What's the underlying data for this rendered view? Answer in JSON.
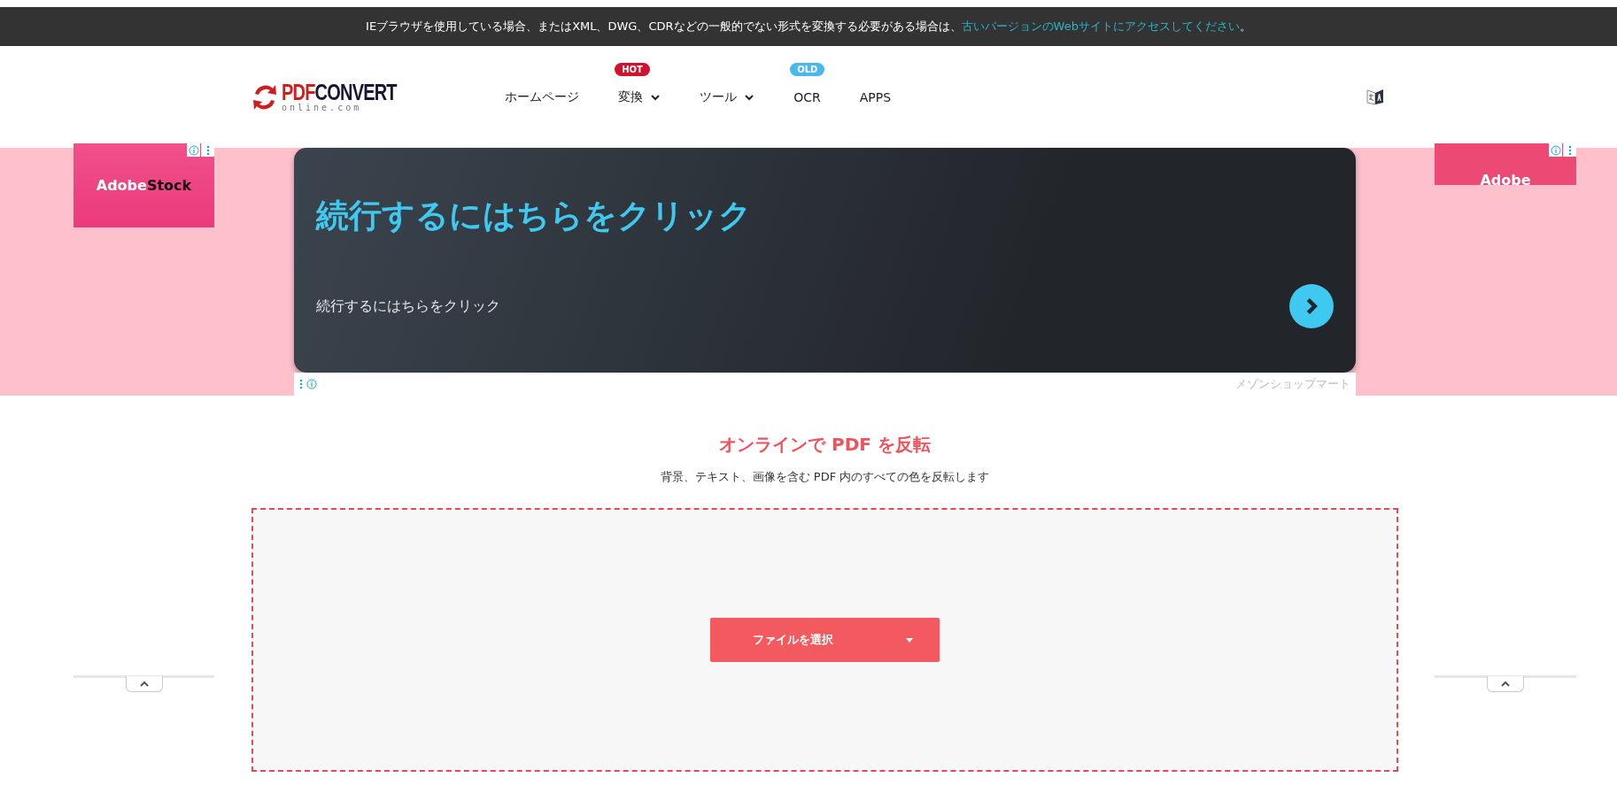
{
  "notice_bar": {
    "text": "IEブラウザを使用している場合、またはXML、DWG、CDRなどの一般的でない形式を変換する必要がある場合は、",
    "link": "古いバージョンのWebサイトにアクセスしてください",
    "end": "。"
  },
  "header": {
    "logo": {
      "brand_a": "PDF",
      "brand_b": "CONVERT",
      "domain": "online.com"
    },
    "nav": [
      {
        "label": "ホームページ",
        "dropdown": false
      },
      {
        "label": "変換",
        "dropdown": true,
        "badge": {
          "text": "HOT",
          "color": "#d0122e"
        }
      },
      {
        "label": "ツール",
        "dropdown": true
      },
      {
        "label": "OCR",
        "dropdown": false,
        "badge": {
          "text": "OLD",
          "color": "#4ab8ee"
        }
      },
      {
        "label": "APPS",
        "dropdown": false
      }
    ]
  },
  "ads": {
    "left": {
      "brand_a": "Adobe",
      "brand_b": "Stock"
    },
    "right": {
      "brand_a": "Adobe"
    },
    "banner": {
      "headline": "続行するにはちらをクリック",
      "text": "続行するにはちらをクリック",
      "advertiser": "メゾンショップマート"
    }
  },
  "main": {
    "title": "オンラインで PDF を反転",
    "subtitle": "背景、テキスト、画像を含む PDF 内のすべての色を反転します",
    "select_button": "ファイルを選択"
  }
}
